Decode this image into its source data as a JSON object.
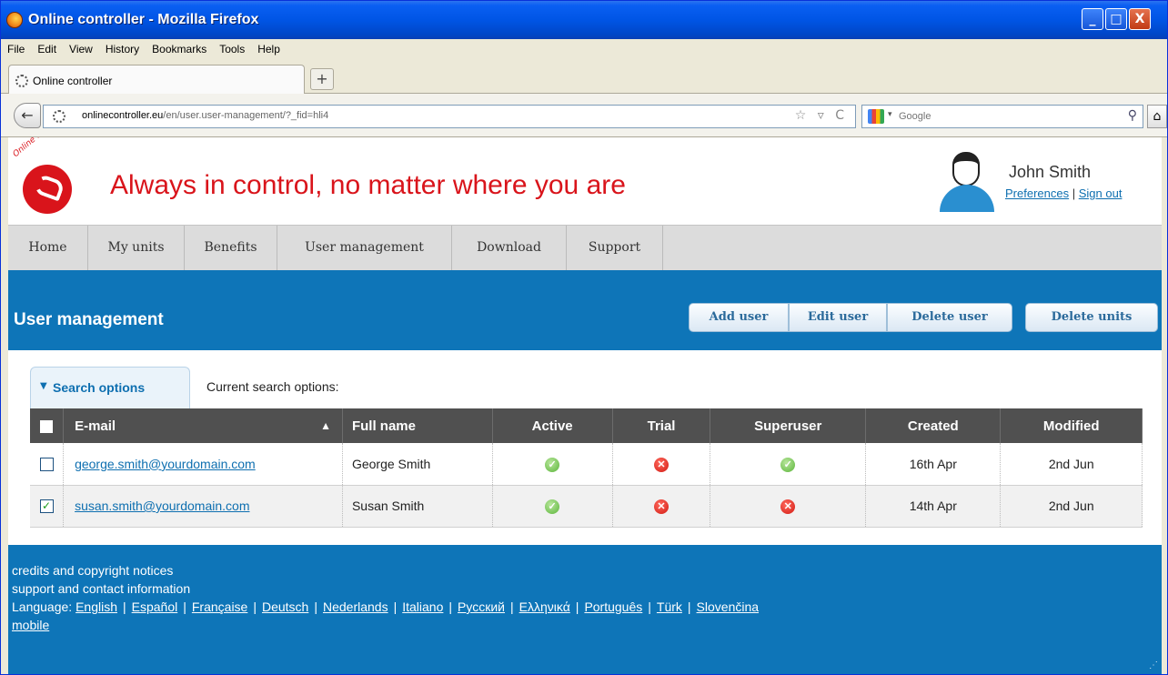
{
  "window": {
    "title": "Online controller - Mozilla Firefox",
    "minimize": "_",
    "maximize": "□",
    "close": "X"
  },
  "menu": [
    "File",
    "Edit",
    "View",
    "History",
    "Bookmarks",
    "Tools",
    "Help"
  ],
  "tab": {
    "label": "Online controller",
    "new_tab": "+"
  },
  "nav": {
    "back": "←",
    "url_host": "onlinecontroller.eu",
    "url_path": "/en/user.user-management/?_fid=hli4",
    "url_icons": "☆ ▿ C",
    "search_placeholder": "Google",
    "search_caret": "▾",
    "search_icon": "⚲",
    "home": "⌂"
  },
  "header": {
    "logo_text": "Online controller",
    "slogan": "Always in control, no matter where you are",
    "user_name": "John Smith",
    "preferences": "Preferences",
    "separator": "|",
    "sign_out": "Sign out"
  },
  "main_nav": [
    "Home",
    "My units",
    "Benefits",
    "User management",
    "Download",
    "Support"
  ],
  "page": {
    "title": "User management",
    "buttons": {
      "add_user": "Add user",
      "edit_user": "Edit user",
      "delete_user": "Delete user",
      "delete_units": "Delete units"
    }
  },
  "search": {
    "tab_label": "Search options",
    "funnel": "▼",
    "current": "Current search options:"
  },
  "table": {
    "columns": {
      "email": "E-mail",
      "full_name": "Full name",
      "active": "Active",
      "trial": "Trial",
      "superuser": "Superuser",
      "created": "Created",
      "modified": "Modified"
    },
    "sort_arrow": "▲",
    "rows": [
      {
        "checked": false,
        "email": "george.smith@yourdomain.com",
        "full_name": "George Smith",
        "active": true,
        "trial": false,
        "superuser": true,
        "created": "16th Apr",
        "modified": "2nd Jun"
      },
      {
        "checked": true,
        "email": "susan.smith@yourdomain.com",
        "full_name": "Susan Smith",
        "active": true,
        "trial": false,
        "superuser": false,
        "created": "14th Apr",
        "modified": "2nd Jun"
      }
    ],
    "check_mark": "✓",
    "ok_mark": "✓",
    "no_mark": "✕"
  },
  "footer": {
    "credits": "credits and copyright notices",
    "support": "support and contact information",
    "language_label": "Language:",
    "languages": [
      "English",
      "Español",
      "Française",
      "Deutsch",
      "Nederlands",
      "Italiano",
      "Русский",
      "Ελληνικά",
      "Português",
      "Türk",
      "Slovenčina"
    ],
    "mobile": "mobile"
  },
  "colors": {
    "brand_red": "#d9141b",
    "band_blue": "#0e75b8",
    "header_gray": "#505050"
  }
}
